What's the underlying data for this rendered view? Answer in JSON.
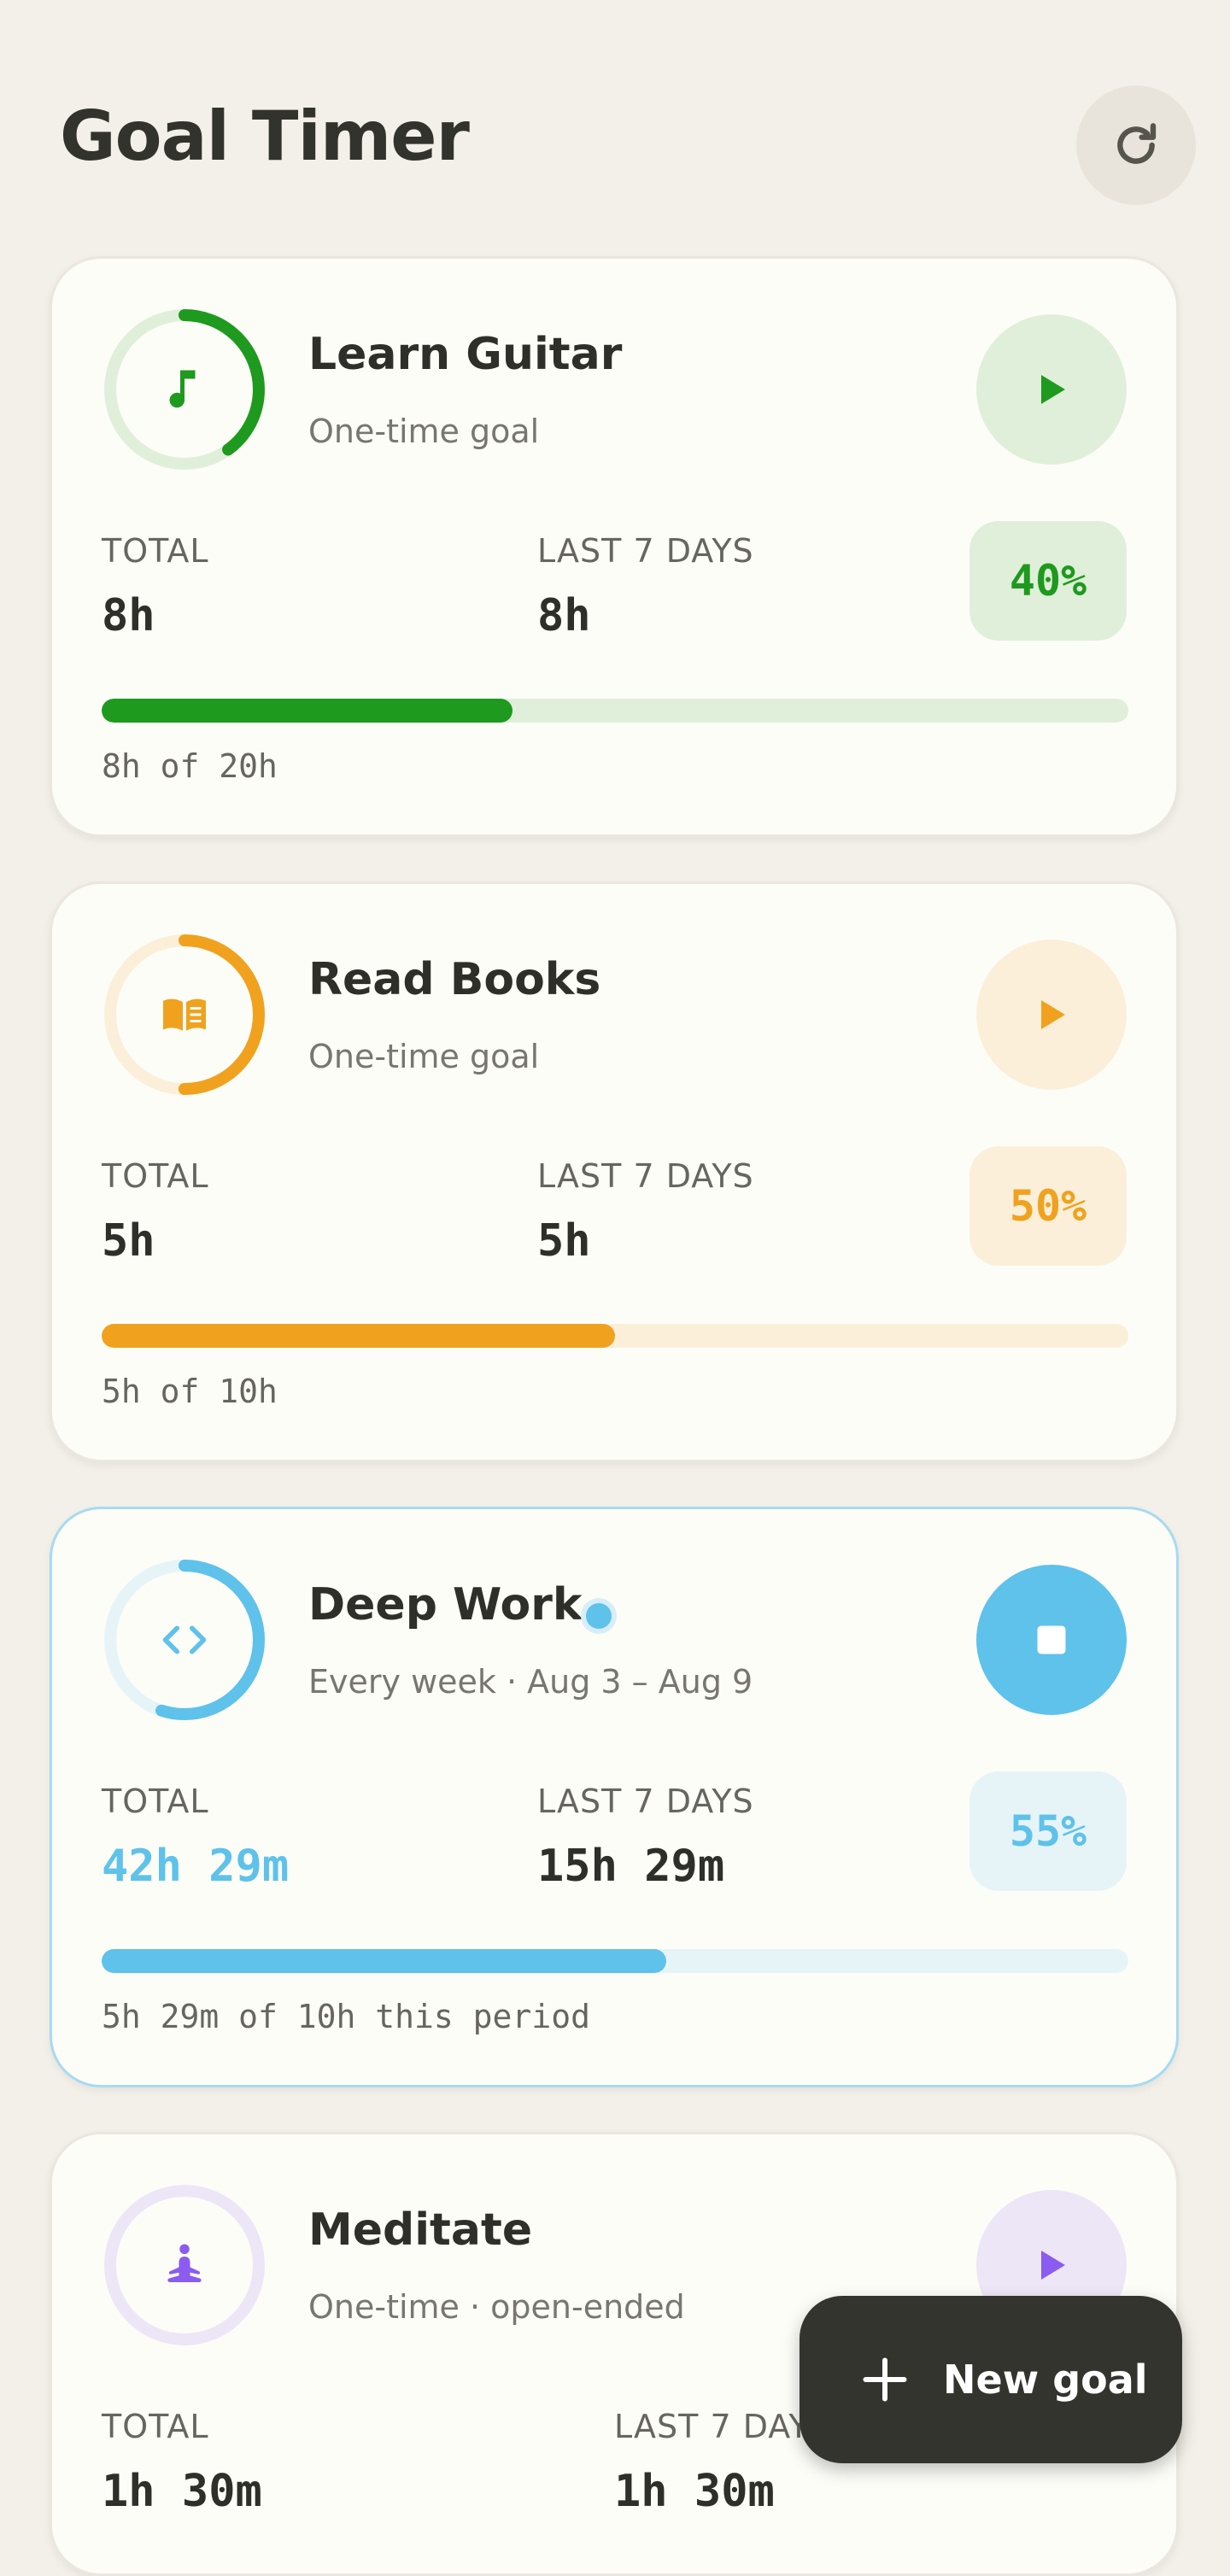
{
  "header": {
    "title": "Goal Timer",
    "refresh_icon": "refresh-icon"
  },
  "goals": [
    {
      "name": "Learn Guitar",
      "subtitle": "One-time goal",
      "icon": "music-note-icon",
      "color": "#1e9a1e",
      "tint": "#e0efd9",
      "ring_progress": 0.4,
      "action": "play",
      "total_label": "TOTAL",
      "total_value": "8h",
      "last7_label": "LAST 7 DAYS",
      "last7_value": "8h",
      "percent": "40%",
      "progress": 0.4,
      "progress_note": "8h of 20h"
    },
    {
      "name": "Read Books",
      "subtitle": "One-time goal",
      "icon": "book-icon",
      "color": "#f0a21e",
      "tint": "#fbefd9",
      "ring_progress": 0.5,
      "action": "play",
      "total_label": "TOTAL",
      "total_value": "5h",
      "last7_label": "LAST 7 DAYS",
      "last7_value": "5h",
      "percent": "50%",
      "progress": 0.5,
      "progress_note": "5h of 10h"
    },
    {
      "name": "Deep Work",
      "subtitle": "Every week · Aug 3 – Aug 9",
      "icon": "code-icon",
      "color": "#5ec2ea",
      "tint": "#e6f4f8",
      "ring_progress": 0.55,
      "action": "stop",
      "active": true,
      "total_label": "TOTAL",
      "total_value": "42h 29m",
      "last7_label": "LAST 7 DAYS",
      "last7_value": "15h 29m",
      "percent": "55%",
      "progress": 0.55,
      "progress_note": "5h 29m of 10h this period"
    },
    {
      "name": "Meditate",
      "subtitle": "One-time · open-ended",
      "icon": "meditation-icon",
      "color": "#8b5cf0",
      "tint": "#ece6f7",
      "ring_progress": 0,
      "action": "play",
      "total_label": "TOTAL",
      "total_value": "1h 30m",
      "last7_label": "LAST 7 DAYS",
      "last7_value": "1h 30m"
    }
  ],
  "fab": {
    "label": "New goal",
    "icon": "plus-icon"
  }
}
